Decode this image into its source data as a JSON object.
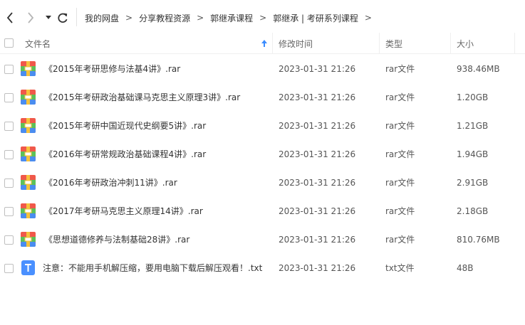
{
  "nav": {
    "back_icon": "chevron-left-icon",
    "forward_icon": "chevron-right-icon",
    "history_icon": "caret-down-icon",
    "refresh_icon": "refresh-icon"
  },
  "breadcrumb": {
    "items": [
      "我的网盘",
      "分享教程资源",
      "郭继承课程",
      "郭继承 | 考研系列课程"
    ],
    "separator": ">"
  },
  "table": {
    "columns": {
      "name": "文件名",
      "modified": "修改时间",
      "type": "类型",
      "size": "大小"
    },
    "sort_icon": "sort-ascending-arrow-icon",
    "rows": [
      {
        "name": "《2015年考研思修与法基4讲》.rar",
        "modified": "2023-01-31 21:26",
        "type": "rar文件",
        "size": "938.46MB",
        "icon": "rar-archive-icon"
      },
      {
        "name": "《2015年考研政治基础课马克思主义原理3讲》.rar",
        "modified": "2023-01-31 21:26",
        "type": "rar文件",
        "size": "1.20GB",
        "icon": "rar-archive-icon"
      },
      {
        "name": "《2015年考研中国近现代史纲要5讲》.rar",
        "modified": "2023-01-31 21:26",
        "type": "rar文件",
        "size": "1.21GB",
        "icon": "rar-archive-icon"
      },
      {
        "name": "《2016年考研常规政治基础课程4讲》.rar",
        "modified": "2023-01-31 21:26",
        "type": "rar文件",
        "size": "1.94GB",
        "icon": "rar-archive-icon"
      },
      {
        "name": "《2016年考研政治冲刺11讲》.rar",
        "modified": "2023-01-31 21:26",
        "type": "rar文件",
        "size": "2.91GB",
        "icon": "rar-archive-icon"
      },
      {
        "name": "《2017年考研马克思主义原理14讲》.rar",
        "modified": "2023-01-31 21:26",
        "type": "rar文件",
        "size": "2.18GB",
        "icon": "rar-archive-icon"
      },
      {
        "name": "《思想道德修养与法制基础28讲》.rar",
        "modified": "2023-01-31 21:26",
        "type": "rar文件",
        "size": "810.76MB",
        "icon": "rar-archive-icon"
      },
      {
        "name": "注意：不能用手机解压缩，要用电脑下载后解压观看！.txt",
        "modified": "2023-01-31 21:26",
        "type": "txt文件",
        "size": "48B",
        "icon": "txt-file-icon"
      }
    ]
  },
  "colors": {
    "accent": "#3b8cff",
    "txt_icon": "#4a90ff",
    "rar_red": "#f0584a",
    "rar_green": "#5cc15a",
    "rar_blue": "#4a8df0",
    "rar_yellow": "#f7c23c"
  }
}
